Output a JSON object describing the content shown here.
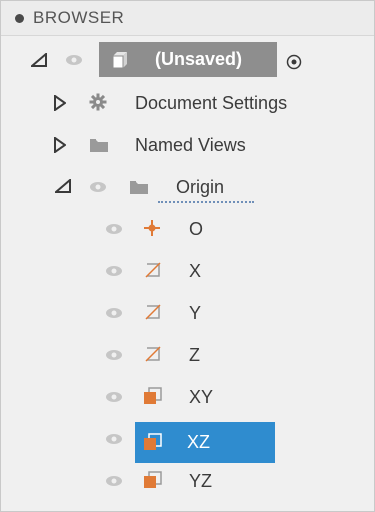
{
  "panel": {
    "title": "BROWSER"
  },
  "root": {
    "label": "(Unsaved)"
  },
  "tree": {
    "document_settings": "Document Settings",
    "named_views": "Named Views",
    "origin": "Origin",
    "origin_items": [
      "O",
      "X",
      "Y",
      "Z",
      "XY",
      "XZ",
      "YZ"
    ]
  },
  "colors": {
    "selection": "#2f8ccf",
    "root_highlight": "#8e8e8e",
    "plane_orange": "#e07a36",
    "axis_orange": "#e07a36"
  },
  "selected_item": "XZ"
}
